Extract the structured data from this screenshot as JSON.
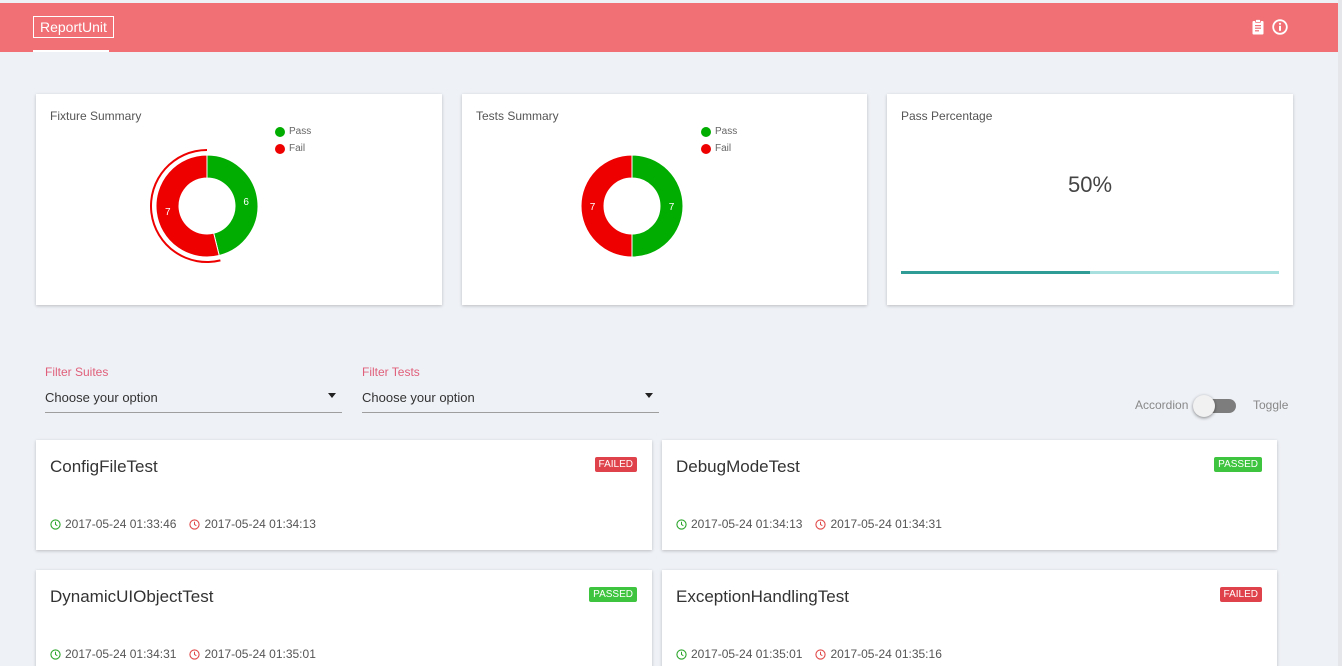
{
  "app": {
    "brand": "ReportUnit"
  },
  "colors": {
    "header": "#f07075",
    "pass": "#00ad00",
    "fail": "#ee0000",
    "progress_fill": "#2f9c95",
    "progress_track": "#a8dfdf"
  },
  "toolbar": {
    "icons": [
      "clipboard-icon",
      "info-icon"
    ]
  },
  "summary": {
    "fixture": {
      "title": "Fixture Summary",
      "legend": [
        "Pass",
        "Fail"
      ],
      "pass": 6,
      "fail": 7,
      "pass_label": "6",
      "fail_label": "7"
    },
    "tests": {
      "title": "Tests Summary",
      "legend": [
        "Pass",
        "Fail"
      ],
      "pass": 7,
      "fail": 7,
      "pass_label": "7",
      "fail_label": "7"
    },
    "percentage": {
      "title": "Pass Percentage",
      "value_text": "50%",
      "fraction": 0.5
    }
  },
  "filters": {
    "suites": {
      "label": "Filter Suites",
      "value": "Choose your option"
    },
    "tests": {
      "label": "Filter Tests",
      "value": "Choose your option"
    }
  },
  "view_switch": {
    "left_label": "Accordion",
    "right_label": "Toggle"
  },
  "tests": [
    {
      "name": "ConfigFileTest",
      "status": "FAILED",
      "start": "2017-05-24 01:33:46",
      "end": "2017-05-24 01:34:13"
    },
    {
      "name": "DebugModeTest",
      "status": "PASSED",
      "start": "2017-05-24 01:34:13",
      "end": "2017-05-24 01:34:31"
    },
    {
      "name": "DynamicUIObjectTest",
      "status": "PASSED",
      "start": "2017-05-24 01:34:31",
      "end": "2017-05-24 01:35:01"
    },
    {
      "name": "ExceptionHandlingTest",
      "status": "FAILED",
      "start": "2017-05-24 01:35:01",
      "end": "2017-05-24 01:35:16"
    }
  ]
}
